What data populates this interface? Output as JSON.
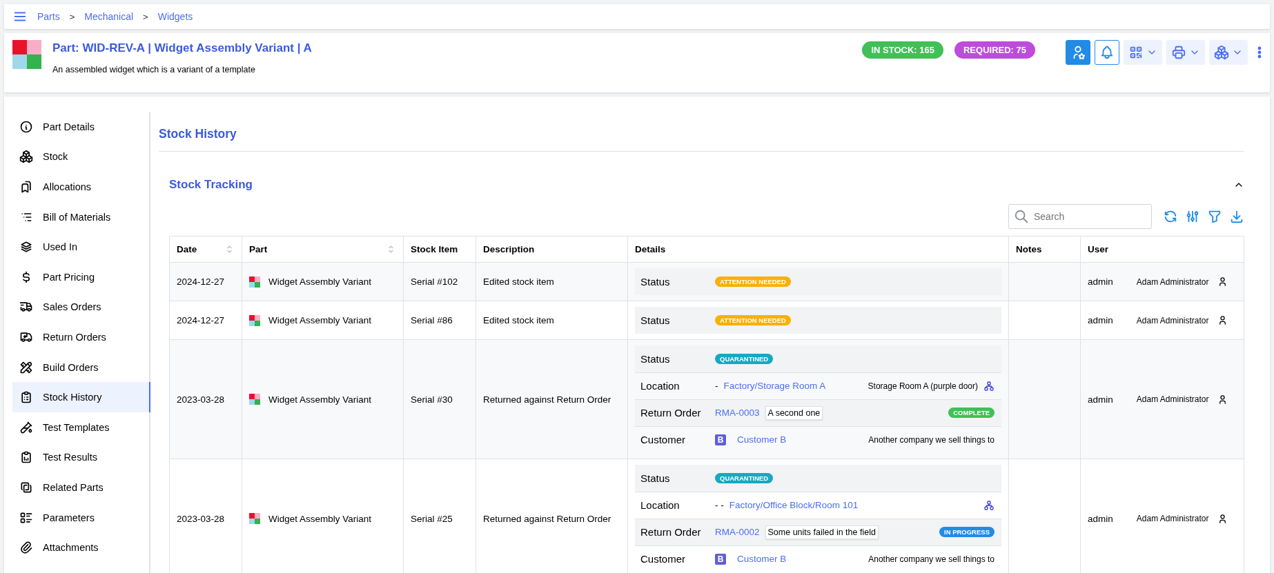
{
  "breadcrumbs": {
    "separator": ">",
    "items": [
      "Parts",
      "Mechanical",
      "Widgets"
    ]
  },
  "part": {
    "title": "Part: WID-REV-A | Widget Assembly Variant | A",
    "description": "An assembled widget which is a variant of a template",
    "badges": [
      {
        "label": "IN STOCK: 165",
        "color": "#40c057"
      },
      {
        "label": "REQUIRED: 75",
        "color": "#be4bdb"
      }
    ]
  },
  "sidebar": {
    "items": [
      {
        "label": "Part Details",
        "selected": false
      },
      {
        "label": "Stock",
        "selected": false
      },
      {
        "label": "Allocations",
        "selected": false
      },
      {
        "label": "Bill of Materials",
        "selected": false
      },
      {
        "label": "Used In",
        "selected": false
      },
      {
        "label": "Part Pricing",
        "selected": false
      },
      {
        "label": "Sales Orders",
        "selected": false
      },
      {
        "label": "Return Orders",
        "selected": false
      },
      {
        "label": "Build Orders",
        "selected": false
      },
      {
        "label": "Stock History",
        "selected": true
      },
      {
        "label": "Test Templates",
        "selected": false
      },
      {
        "label": "Test Results",
        "selected": false
      },
      {
        "label": "Related Parts",
        "selected": false
      },
      {
        "label": "Parameters",
        "selected": false
      },
      {
        "label": "Attachments",
        "selected": false
      }
    ]
  },
  "page_title": "Stock History",
  "panel": {
    "title": "Stock Tracking",
    "expanded": true,
    "search": {
      "placeholder": "Search"
    },
    "table": {
      "columns": [
        {
          "label": "Date",
          "sortable": true
        },
        {
          "label": "Part",
          "sortable": true
        },
        {
          "label": "Stock Item",
          "sortable": false
        },
        {
          "label": "Description",
          "sortable": false
        },
        {
          "label": "Details",
          "sortable": false
        },
        {
          "label": "Notes",
          "sortable": false
        },
        {
          "label": "User",
          "sortable": false
        }
      ],
      "rows": [
        {
          "date": "2024-12-27",
          "part": "Widget Assembly Variant",
          "stock_item": "Serial #102",
          "description": "Edited stock item",
          "user": "admin",
          "user_name": "Adam Administrator",
          "details": [
            {
              "kind": "status",
              "label": "Status",
              "badge": "ATTENTION NEEDED",
              "color": "#fab005"
            }
          ]
        },
        {
          "date": "2024-12-27",
          "part": "Widget Assembly Variant",
          "stock_item": "Serial #86",
          "description": "Edited stock item",
          "user": "admin",
          "user_name": "Adam Administrator",
          "details": [
            {
              "kind": "status",
              "label": "Status",
              "badge": "ATTENTION NEEDED",
              "color": "#fab005"
            }
          ]
        },
        {
          "date": "2023-03-28",
          "part": "Widget Assembly Variant",
          "stock_item": "Serial #30",
          "description": "Returned against Return Order",
          "user": "admin",
          "user_name": "Adam Administrator",
          "details": [
            {
              "kind": "status",
              "label": "Status",
              "badge": "QUARANTINED",
              "color": "#15aabf"
            },
            {
              "kind": "location",
              "label": "Location",
              "prefix": "-",
              "link": "Factory/Storage Room A",
              "description": "Storage Room A (purple door)"
            },
            {
              "kind": "order",
              "label": "Return Order",
              "link": "RMA-0003",
              "note": "A second one",
              "badge": "COMPLETE",
              "color": "#40c057"
            },
            {
              "kind": "customer",
              "label": "Customer",
              "avatar": "B",
              "link": "Customer B",
              "description": "Another company we sell things to"
            }
          ]
        },
        {
          "date": "2023-03-28",
          "part": "Widget Assembly Variant",
          "stock_item": "Serial #25",
          "description": "Returned against Return Order",
          "user": "admin",
          "user_name": "Adam Administrator",
          "details": [
            {
              "kind": "status",
              "label": "Status",
              "badge": "QUARANTINED",
              "color": "#15aabf"
            },
            {
              "kind": "location",
              "label": "Location",
              "prefix": "- -",
              "link": "Factory/Office Block/Room 101"
            },
            {
              "kind": "order",
              "label": "Return Order",
              "link": "RMA-0002",
              "note": "Some units failed in the field",
              "badge": "IN PROGRESS",
              "color": "#228be6"
            },
            {
              "kind": "customer",
              "label": "Customer",
              "avatar": "B",
              "link": "Customer B",
              "description": "Another company we sell things to"
            }
          ]
        }
      ]
    }
  }
}
